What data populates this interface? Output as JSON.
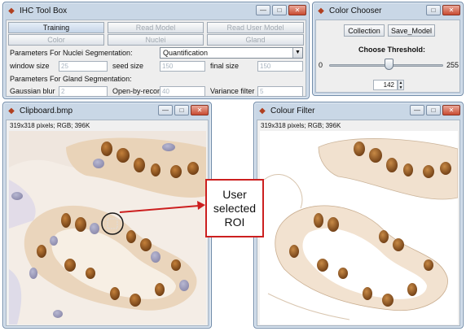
{
  "toolbox": {
    "title": "IHC Tool Box",
    "buttons_row1": [
      "Training",
      "Read Model",
      "Read User Model"
    ],
    "buttons_row2": [
      "Color",
      "Nuclei",
      "Gland"
    ],
    "nuclei_label": "Parameters For Nuclei Segmentation:",
    "nuclei_mode": "Quantification",
    "window_size_label": "window size",
    "window_size": "25",
    "seed_size_label": "seed size",
    "seed_size": "150",
    "final_size_label": "final size",
    "final_size": "150",
    "gland_label": "Parameters For Gland Segmentation:",
    "gaussian_label": "Gaussian blur",
    "gaussian": "2",
    "open_recon_label": "Open-by-recon",
    "open_recon": "40",
    "variance_label": "Variance filter",
    "variance": "5"
  },
  "color_chooser": {
    "title": "Color Chooser",
    "collection_label": "Collection",
    "save_label": "Save_Model",
    "threshold_label": "Choose Threshold:",
    "slider_min": "0",
    "slider_max": "255",
    "threshold_value": "142"
  },
  "clipboard_window": {
    "title": "Clipboard.bmp",
    "info": "319x318 pixels; RGB; 396K"
  },
  "colour_filter_window": {
    "title": "Colour Filter",
    "info": "319x318 pixels; RGB; 396K"
  },
  "annotation": {
    "text_lines": [
      "User",
      "selected",
      "ROI"
    ],
    "color": "#cc1f1f"
  }
}
